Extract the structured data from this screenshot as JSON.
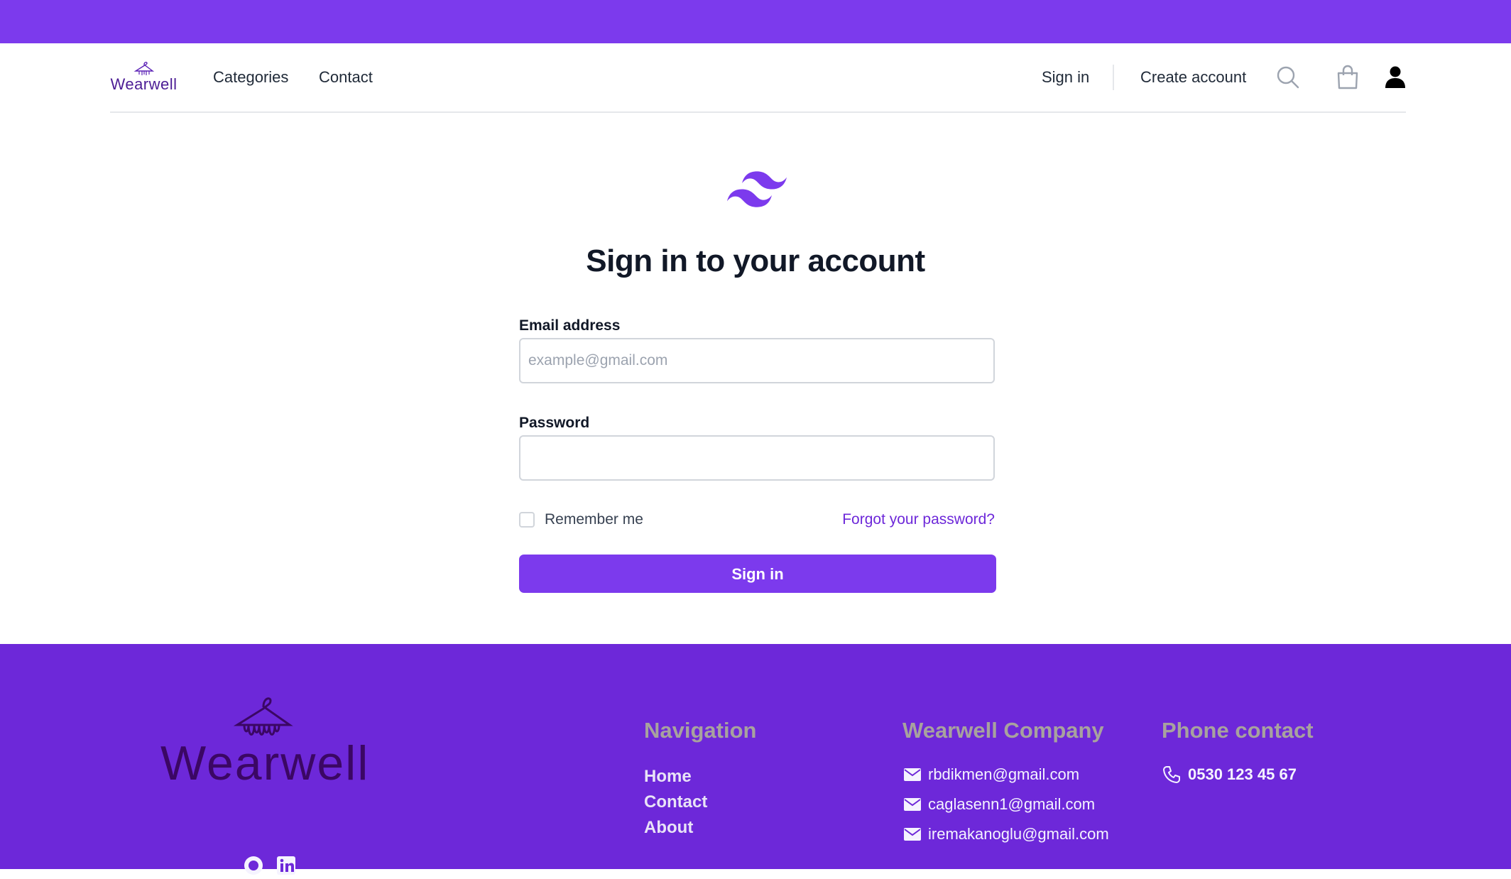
{
  "brand": {
    "name": "Wearwell",
    "accent": "#7c3aed",
    "footer_bg": "#6d28d9"
  },
  "nav": {
    "links": [
      {
        "label": "Categories"
      },
      {
        "label": "Contact"
      }
    ],
    "sign_in": "Sign in",
    "create_account": "Create account",
    "icons": [
      "search-icon",
      "shopping-bag-icon",
      "user-icon"
    ]
  },
  "signin": {
    "title": "Sign in to your account",
    "email": {
      "label": "Email address",
      "placeholder": "example@gmail.com",
      "value": ""
    },
    "password": {
      "label": "Password",
      "value": ""
    },
    "remember_label": "Remember me",
    "remember_checked": false,
    "forgot_label": "Forgot your password?",
    "submit_label": "Sign in"
  },
  "footer": {
    "logo_text": "Wearwell",
    "social_icons": [
      "github-icon",
      "linkedin-icon"
    ],
    "navigation": {
      "title": "Navigation",
      "links": [
        {
          "label": "Home"
        },
        {
          "label": "Contact"
        },
        {
          "label": "About"
        }
      ]
    },
    "company": {
      "title": "Wearwell Company",
      "emails": [
        "rbdikmen@gmail.com",
        "caglasenn1@gmail.com",
        "iremakanoglu@gmail.com"
      ]
    },
    "phone": {
      "title": "Phone contact",
      "number": "0530 123 45 67"
    }
  }
}
